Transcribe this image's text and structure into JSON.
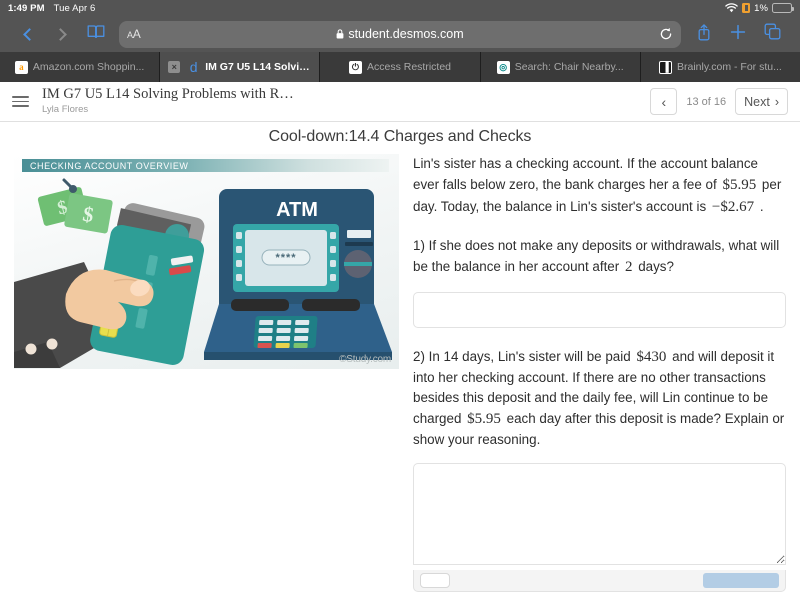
{
  "statusbar": {
    "time": "1:49 PM",
    "date": "Tue Apr 6",
    "battery_percent": "1%",
    "wifi_icon": "wifi-icon",
    "battery_icon": "battery-icon"
  },
  "safari": {
    "back_icon": "back-chevron-icon",
    "forward_icon": "forward-chevron-icon",
    "bookmarks_icon": "book-icon",
    "text_size_label": "AA",
    "lock_icon": "lock-icon",
    "url": "student.desmos.com",
    "reload_icon": "reload-icon",
    "share_icon": "share-icon",
    "new_tab_icon": "plus-icon",
    "tabs_icon": "tabs-overview-icon"
  },
  "tabs": [
    {
      "label": "Amazon.com Shoppin...",
      "favicon": "amazon-favicon",
      "glyph": "a",
      "active": false
    },
    {
      "label": "IM G7 U5 L14 Solving...",
      "favicon": "desmos-favicon",
      "glyph": "d",
      "active": true,
      "close_label": "×"
    },
    {
      "label": "Access Restricted",
      "favicon": "power-favicon",
      "glyph": "⏻",
      "active": false
    },
    {
      "label": "Search: Chair Nearby...",
      "favicon": "search-favicon",
      "glyph": "◎",
      "active": false
    },
    {
      "label": "Brainly.com - For stu...",
      "favicon": "brainly-favicon",
      "glyph": "▐",
      "active": false
    }
  ],
  "header": {
    "menu_icon": "hamburger-menu-icon",
    "title": "IM G7 U5 L14 Solving Problems with R…",
    "subtitle": "Lyla Flores",
    "prev_label": "‹",
    "page_count": "13 of 16",
    "next_label": "Next",
    "next_chevron": "›"
  },
  "lesson": {
    "title": "Cool-down:14.4 Charges and Checks",
    "illustration": {
      "banner": "CHECKING ACCOUNT OVERVIEW",
      "atm_label": "ATM",
      "pin_mask": "∗∗∗∗",
      "watermark": "©Study.com"
    },
    "prompt": {
      "part1": "Lin's sister has a checking account. If the account balance ever falls below zero, the bank charges her a fee of",
      "fee": "$5.95",
      "part2": "per day. Today, the balance in Lin's sister's account is",
      "balance": "−$2.67",
      "part3": "."
    },
    "question1": {
      "part1": "1) If she does not make any deposits or withdrawals, what will be the balance in her account after",
      "days": "2",
      "part2": "days?",
      "answer_value": "",
      "answer_placeholder": ""
    },
    "question2": {
      "part1": "2) In 14 days, Lin's sister will be paid",
      "payment": "$430",
      "part2": "and will deposit it into her checking account. If there are no other transactions besides this deposit and the daily fee, will Lin continue to be charged",
      "fee": "$5.95",
      "part3": "each day after this deposit is made? Explain or show your reasoning.",
      "answer_value": "",
      "answer_placeholder": ""
    }
  },
  "colors": {
    "accent_blue": "#4a90e2",
    "chrome_gray": "#545454",
    "tab_active": "#4e4e4e",
    "atm_body": "#2a5574",
    "card_teal": "#2e9e96",
    "money_green": "#6fbf73",
    "submit_blue": "#b3cde5"
  }
}
